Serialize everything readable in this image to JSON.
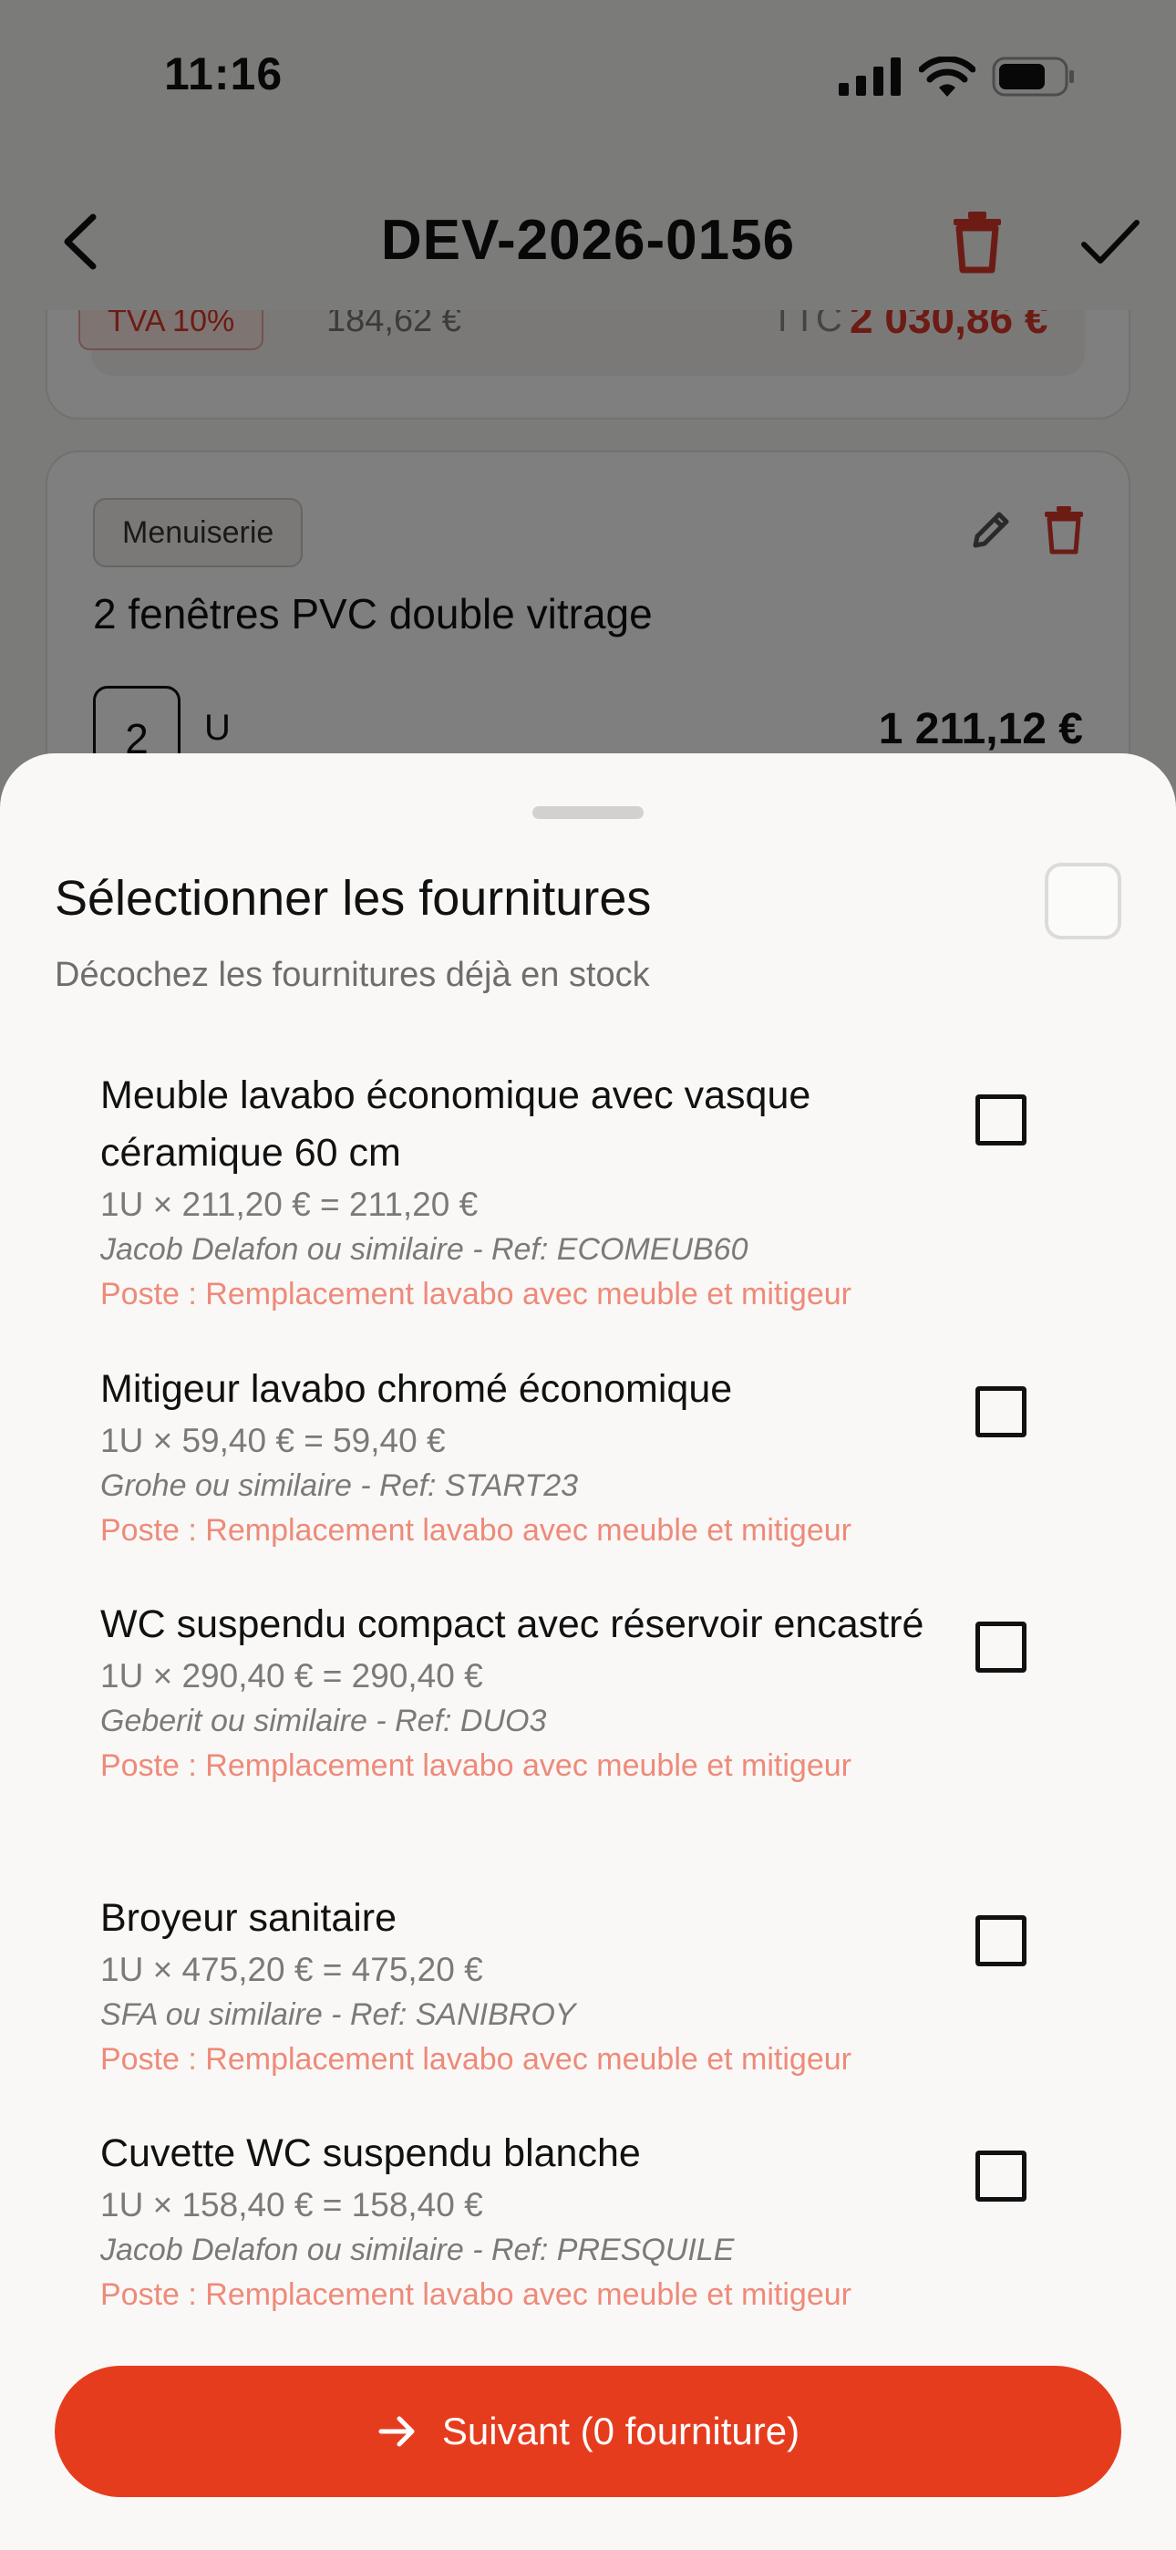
{
  "status_bar": {
    "time": "11:16"
  },
  "nav": {
    "title": "DEV-2026-0156"
  },
  "prev_card": {
    "tva_badge": "TVA 10%",
    "tva_amount": "184,62 €",
    "ttc_label": "TTC",
    "ttc_amount": "2 030,86 €"
  },
  "menu_card": {
    "category": "Menuiserie",
    "title": "2 fenêtres PVC double vitrage",
    "quantity": "2",
    "unit": "U",
    "total": "1 211,12 €"
  },
  "sheet": {
    "title": "Sélectionner les fournitures",
    "subtitle": "Décochez les fournitures déjà en stock",
    "items": [
      {
        "name": "Meuble lavabo économique avec vasque céramique 60 cm",
        "calc": "1U × 211,20 € = 211,20 €",
        "ref": "Jacob Delafon ou similaire - Ref: ECOMEUB60",
        "poste": "Poste : Remplacement lavabo avec meuble et mitigeur",
        "checked": false
      },
      {
        "name": "Mitigeur lavabo chromé économique",
        "calc": "1U × 59,40 € = 59,40 €",
        "ref": "Grohe ou similaire - Ref: START23",
        "poste": "Poste : Remplacement lavabo avec meuble et mitigeur",
        "checked": false
      },
      {
        "name": "WC suspendu compact avec réservoir encastré",
        "calc": "1U × 290,40 € = 290,40 €",
        "ref": "Geberit ou similaire - Ref: DUO3",
        "poste": "Poste : Remplacement lavabo avec meuble et mitigeur",
        "checked": false
      },
      {
        "name": "Broyeur sanitaire",
        "calc": "1U × 475,20 € = 475,20 €",
        "ref": "SFA ou similaire - Ref: SANIBROY",
        "poste": "Poste : Remplacement lavabo avec meuble et mitigeur",
        "checked": false
      },
      {
        "name": "Cuvette WC suspendu blanche",
        "calc": "1U × 158,40 € = 158,40 €",
        "ref": "Jacob Delafon ou similaire - Ref: PRESQUILE",
        "poste": "Poste : Remplacement lavabo avec meuble et mitigeur",
        "checked": false
      }
    ],
    "next_button": "Suivant (0 fourniture)"
  },
  "colors": {
    "accent": "#e63c1e",
    "danger": "#d8392b",
    "poste": "#ee8a7a"
  }
}
